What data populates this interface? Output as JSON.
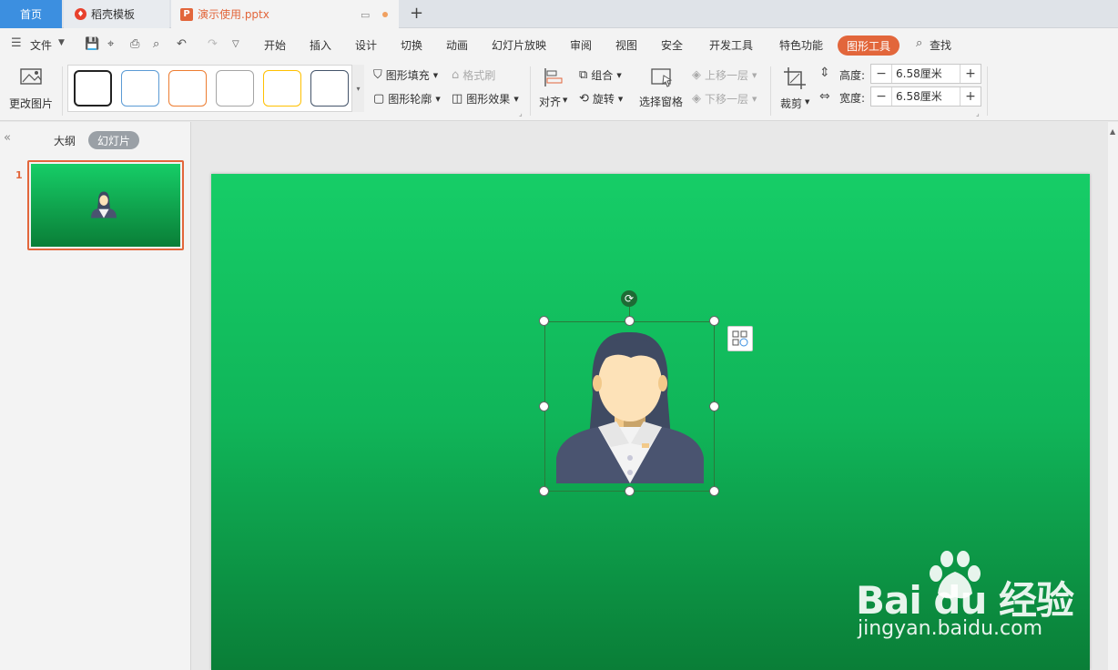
{
  "tabs": {
    "home": "首页",
    "template": "稻壳模板",
    "document": "演示使用.pptx",
    "new_tab": "+"
  },
  "menu": {
    "file": "文件",
    "items": [
      "开始",
      "插入",
      "设计",
      "切换",
      "动画",
      "幻灯片放映",
      "审阅",
      "视图",
      "安全",
      "开发工具",
      "特色功能"
    ],
    "active": "图形工具",
    "search": "查找"
  },
  "ribbon": {
    "change_picture": "更改图片",
    "shape_fill": "图形填充",
    "format_painter": "格式刷",
    "shape_outline": "图形轮廓",
    "shape_effects": "图形效果",
    "align": "对齐",
    "group": "组合",
    "rotate": "旋转",
    "selection_pane": "选择窗格",
    "bring_forward": "上移一层",
    "send_backward": "下移一层",
    "crop": "裁剪",
    "height_label": "高度:",
    "height_value": "6.58厘米",
    "width_label": "宽度:",
    "width_value": "6.58厘米",
    "style_colors": [
      "#222222",
      "#5b9bd5",
      "#ed7d31",
      "#a5a5a5",
      "#ffc000",
      "#44546a"
    ]
  },
  "left_panel": {
    "outline": "大纲",
    "slides": "幻灯片",
    "slide_number": "1"
  },
  "slide": {
    "gradient_top": "#16cd67",
    "gradient_bottom": "#0a7e37"
  },
  "watermark": {
    "brand": "Bai du 经验",
    "url": "jingyan.baidu.com"
  },
  "colors": {
    "accent": "#e2663b",
    "home_tab": "#3c8fe0"
  }
}
